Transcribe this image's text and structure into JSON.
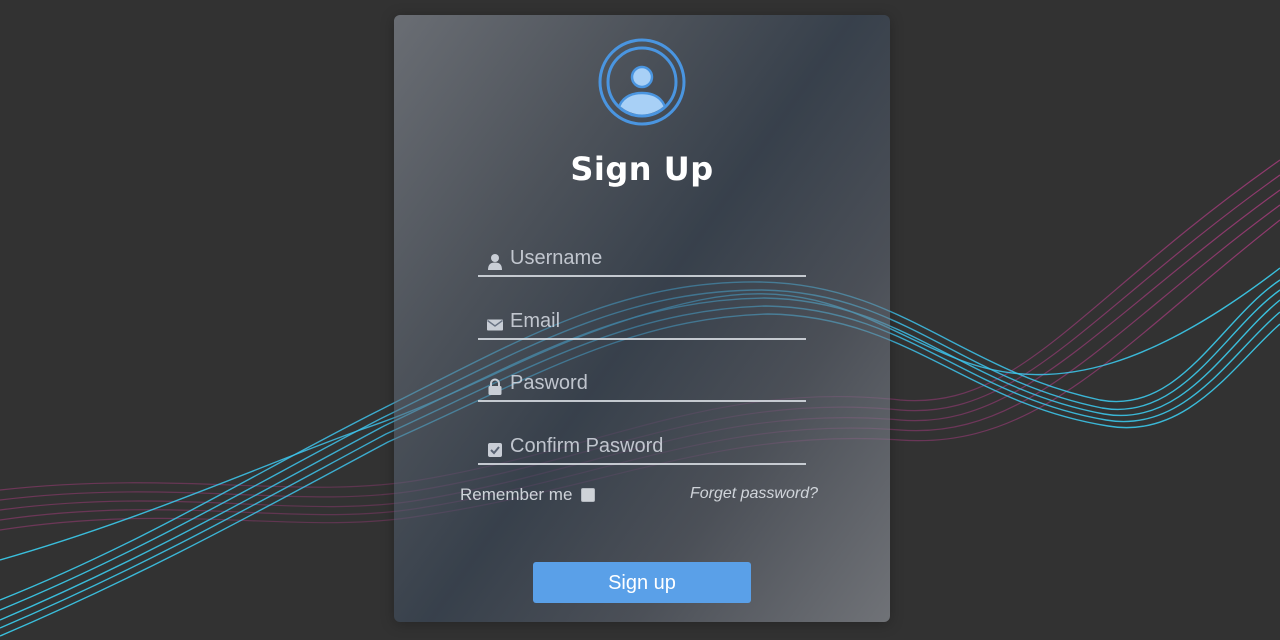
{
  "form": {
    "title": "Sign Up",
    "fields": [
      {
        "placeholder": "Username",
        "value": "",
        "icon": "user-icon"
      },
      {
        "placeholder": "Email",
        "value": "",
        "icon": "envelope-icon"
      },
      {
        "placeholder": "Pasword",
        "value": "",
        "icon": "lock-icon"
      },
      {
        "placeholder": "Confirm Pasword",
        "value": "",
        "icon": "checkbox-icon"
      }
    ],
    "remember_label": "Remember me",
    "remember_checked": false,
    "forget_label": "Forget password?",
    "submit_label": "Sign up"
  },
  "colors": {
    "background": "#323232",
    "accent": "#5aa0e8",
    "avatar_ring": "#4a95e0",
    "avatar_fill": "#a8d0f6"
  }
}
